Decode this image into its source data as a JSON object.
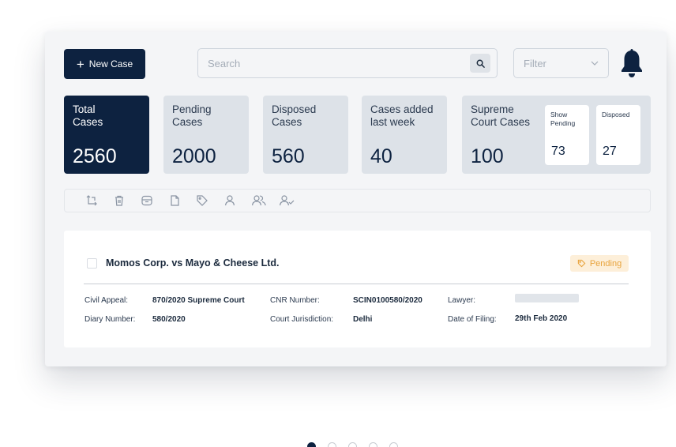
{
  "toolbar": {
    "new_case_label": "New Case",
    "search_placeholder": "Search",
    "filter_label": "Filter"
  },
  "stats": [
    {
      "label": "Total\nCases",
      "value": "2560"
    },
    {
      "label": "Pending\nCases",
      "value": "2000"
    },
    {
      "label": "Disposed\nCases",
      "value": "560"
    },
    {
      "label": "Cases added\nlast week",
      "value": "40"
    },
    {
      "label": "Supreme\nCourt Cases",
      "value": "100",
      "sub": [
        {
          "label": "Show\nPending",
          "value": "73"
        },
        {
          "label": "Disposed",
          "value": "27"
        }
      ]
    }
  ],
  "actions": [
    "transfer-icon",
    "trash-icon",
    "archive-icon",
    "document-icon",
    "tag-icon",
    "user-icon",
    "users-icon",
    "user-check-icon"
  ],
  "case": {
    "title": "Momos Corp. vs Mayo & Cheese Ltd.",
    "status": "Pending",
    "fields": {
      "civil_appeal_label": "Civil Appeal:",
      "civil_appeal_value": "870/2020 Supreme Court",
      "diary_label": "Diary Number:",
      "diary_value": "580/2020",
      "cnr_label": "CNR Number:",
      "cnr_value": "SCIN0100580/2020",
      "jurisdiction_label": "Court Jurisdiction:",
      "jurisdiction_value": "Delhi",
      "lawyer_label": "Lawyer:",
      "filing_label": "Date of Filing:",
      "filing_value": "29th Feb 2020"
    }
  },
  "pagination": {
    "count": 5,
    "active": 0
  },
  "colors": {
    "primary": "#0d2240",
    "pending_bg": "#fdefd9",
    "pending_text": "#e8a33c"
  }
}
